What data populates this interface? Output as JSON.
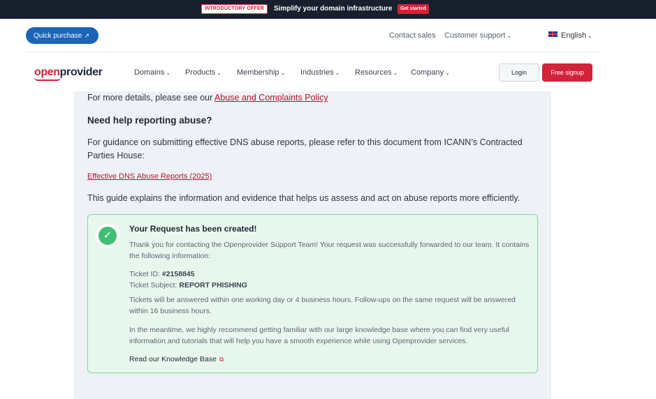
{
  "promo": {
    "badge": "INTRODUCTORY OFFER",
    "text": "Simplify your domain infrastructure",
    "cta": "Get started"
  },
  "utility": {
    "quick_purchase": "Quick purchase",
    "contact_sales": "Contact sales",
    "customer_support": "Customer support",
    "language": "English"
  },
  "logo": {
    "part1": "open",
    "part2": "provider"
  },
  "nav": {
    "items": [
      "Domains",
      "Products",
      "Membership",
      "Industries",
      "Resources",
      "Company"
    ],
    "login": "Login",
    "signup": "Free signup"
  },
  "content": {
    "details_prefix": "For more details, please see our ",
    "policy_link": "Abuse and Complaints Policy",
    "help_heading": "Need help reporting abuse?",
    "guidance": "For guidance on submitting effective DNS abuse reports, please refer to this document from ICANN’s Contracted Parties House:",
    "doc_link": "Effective DNS Abuse Reports (2025)",
    "guide_text": "This guide explains the information and evidence that helps us assess and act on abuse reports more efficiently."
  },
  "success": {
    "title": "Your Request has been created!",
    "intro": "Thank you for contacting the Openprovider Support Team! Your request was successfully forwarded to our team. It contains the following information:",
    "ticket_id_label": "Ticket ID: ",
    "ticket_id": "#2158845",
    "ticket_subject_label": "Ticket Subject: ",
    "ticket_subject": "REPORT PHISHING",
    "response_time": "Tickets will be answered within one working day or 4 business hours. Follow-ups on the same request will be answered within 16 business hours.",
    "recommend": "In the meantime, we highly recommend getting familiar with our large knowledge base where you can find very useful information and tutorials that will help you have a smooth experience while using Openprovider services.",
    "kb_link": "Read our Knowledge Base"
  },
  "colors": {
    "brand_red": "#d3223a",
    "link_blue": "#1b64b8",
    "success_green": "#3fbf74"
  }
}
